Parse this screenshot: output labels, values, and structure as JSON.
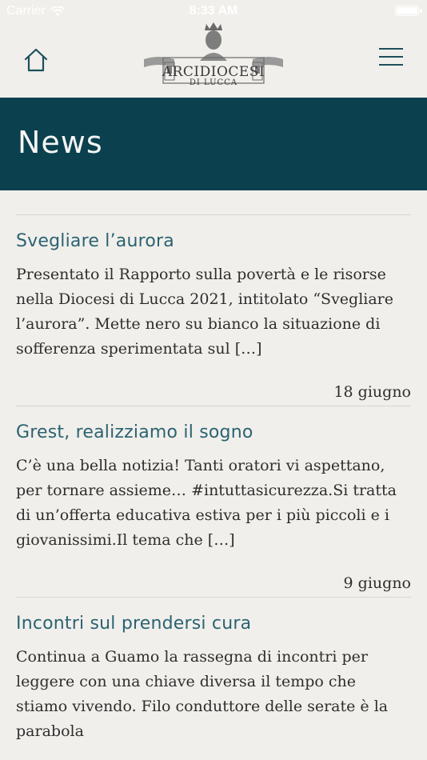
{
  "status_bar": {
    "carrier": "Carrier",
    "time": "8:33 AM"
  },
  "header": {
    "logo_title": "ARCIDIOCESI",
    "logo_subtitle": "DI LUCCA",
    "home_icon": "home-icon",
    "menu_icon": "hamburger-menu-icon"
  },
  "banner": {
    "title": "News"
  },
  "news": [
    {
      "title": "Svegliare l’aurora",
      "excerpt": "Presentato il Rapporto sulla povertà e le risorse nella Diocesi di Lucca 2021, intitolato “Svegliare l’aurora”. Mette nero su bianco la situazione di sofferenza sperimentata sul […]",
      "date": "18 giugno"
    },
    {
      "title": "Grest, realizziamo il sogno",
      "excerpt": "C’è una bella notizia! Tanti oratori vi aspettano, per tornare assieme… #intuttasicurezza.Si tratta di un’offerta educativa estiva per i più piccoli e i giovanissimi.Il tema che […]",
      "date": "9 giugno"
    },
    {
      "title": "Incontri sul prendersi cura",
      "excerpt": "Continua a Guamo la rassegna di incontri per leggere con una chiave diversa il tempo che stiamo vivendo. Filo conduttore delle serate è la parabola"
    }
  ],
  "colors": {
    "background": "#f1efeb",
    "banner": "#0b414e",
    "title": "#2a6372",
    "icon": "#1d4f5c"
  }
}
